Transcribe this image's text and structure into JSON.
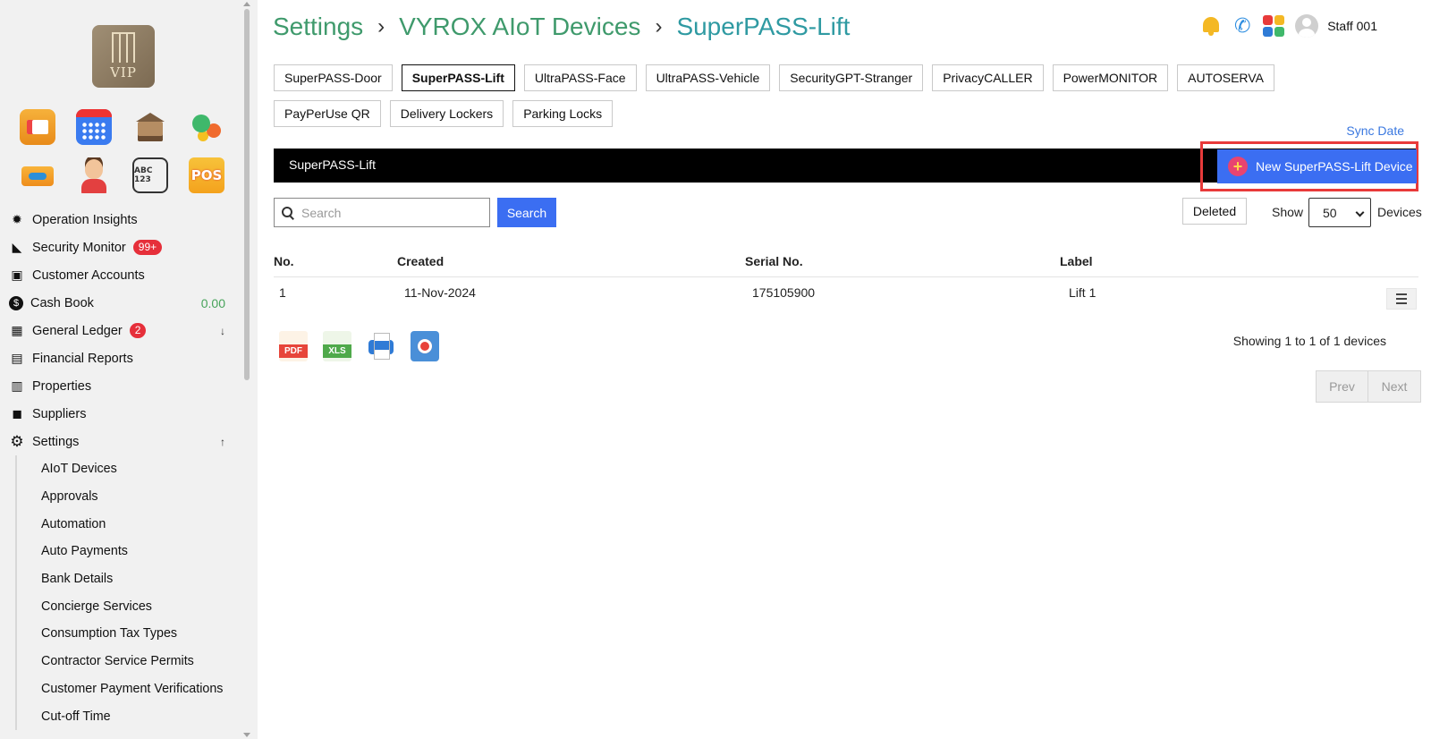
{
  "sidebar": {
    "logo_text": "VIP",
    "app_icons": [
      {
        "name": "id-card-icon"
      },
      {
        "name": "calendar-icon"
      },
      {
        "name": "bank-icon"
      },
      {
        "name": "balloons-icon"
      },
      {
        "name": "key-card-icon"
      },
      {
        "name": "face-recognition-icon"
      },
      {
        "name": "license-plate-icon",
        "text": "ABC 123"
      },
      {
        "name": "pos-icon",
        "text": "POS"
      }
    ],
    "nav": [
      {
        "label": "Operation Insights",
        "icon": "lightbulb-icon"
      },
      {
        "label": "Security Monitor",
        "icon": "cctv-icon",
        "badge": "99+"
      },
      {
        "label": "Customer Accounts",
        "icon": "user-card-icon"
      },
      {
        "label": "Cash Book",
        "icon": "dollar-icon",
        "amount": "0.00"
      },
      {
        "label": "General Ledger",
        "icon": "calculator-icon",
        "badge": "2",
        "arrow": "↓"
      },
      {
        "label": "Financial Reports",
        "icon": "report-icon"
      },
      {
        "label": "Properties",
        "icon": "building-icon"
      },
      {
        "label": "Suppliers",
        "icon": "truck-icon"
      },
      {
        "label": "Settings",
        "icon": "gear-icon",
        "arrow": "↑"
      }
    ],
    "settings_sub": [
      "AIoT Devices",
      "Approvals",
      "Automation",
      "Auto Payments",
      "Bank Details",
      "Concierge Services",
      "Consumption Tax Types",
      "Contractor Service Permits",
      "Customer Payment Verifications",
      "Cut-off Time"
    ]
  },
  "breadcrumb": [
    "Settings",
    "VYROX AIoT Devices",
    "SuperPASS-Lift"
  ],
  "topbar": {
    "user": "Staff 001"
  },
  "tabs": [
    {
      "label": "SuperPASS-Door",
      "active": false
    },
    {
      "label": "SuperPASS-Lift",
      "active": true
    },
    {
      "label": "UltraPASS-Face",
      "active": false
    },
    {
      "label": "UltraPASS-Vehicle",
      "active": false
    },
    {
      "label": "SecurityGPT-Stranger",
      "active": false
    },
    {
      "label": "PrivacyCALLER",
      "active": false
    },
    {
      "label": "PowerMONITOR",
      "active": false
    },
    {
      "label": "AUTOSERVA",
      "active": false
    },
    {
      "label": "PayPerUse QR",
      "active": false
    },
    {
      "label": "Delivery Lockers",
      "active": false
    },
    {
      "label": "Parking Locks",
      "active": false
    }
  ],
  "sync_date": "Sync Date",
  "section": {
    "title": "SuperPASS-Lift",
    "new_button": "New SuperPASS-Lift Device"
  },
  "filters": {
    "search_placeholder": "Search",
    "search_button": "Search",
    "deleted_button": "Deleted",
    "show_label": "Show",
    "show_value": "50",
    "devices_label": "Devices"
  },
  "table": {
    "headers": [
      "No.",
      "Created",
      "Serial No.",
      "Label"
    ],
    "rows": [
      {
        "no": "1",
        "created": "11-Nov-2024",
        "serial": "175105900",
        "label": "Lift 1"
      }
    ]
  },
  "exports": [
    {
      "name": "pdf-export-icon",
      "text": "PDF"
    },
    {
      "name": "xls-export-icon",
      "text": "XLS"
    },
    {
      "name": "print-icon"
    },
    {
      "name": "column-settings-icon"
    }
  ],
  "pagination": {
    "showing": "Showing 1 to 1 of 1 devices",
    "prev": "Prev",
    "next": "Next"
  },
  "colors": {
    "breadcrumb_green": "#3f9a6c",
    "breadcrumb_teal": "#2f9aa2",
    "primary_button": "#3b6ef2",
    "badge_red": "#e62f3a",
    "highlight_border": "#e83a3a"
  }
}
